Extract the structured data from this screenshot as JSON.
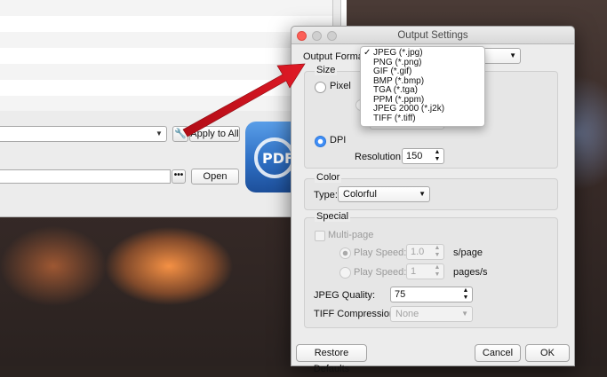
{
  "main_window": {
    "apply_label": "Apply to All",
    "open_label": "Open",
    "ellipsis_label": "•••",
    "wrench_glyph": "🔧",
    "logo_text": "PDF"
  },
  "dialog": {
    "title": "Output Settings",
    "output_format_label": "Output Format:",
    "output_format_selected": "JPEG (*.jpg)",
    "format_options": [
      "JPEG (*.jpg)",
      "PNG (*.png)",
      "GIF (*.gif)",
      "BMP (*.bmp)",
      "TGA (*.tga)",
      "PPM (*.ppm)",
      "JPEG 2000 (*.j2k)",
      "TIFF (*.tiff)"
    ],
    "size_group": "Size",
    "pixel_label": "Pixel",
    "dpi_label": "DPI",
    "resolution_label": "Resolution:",
    "resolution_value": "150",
    "color_group": "Color",
    "type_label": "Type:",
    "type_value": "Colorful",
    "special_group": "Special",
    "multipage_label": "Multi-page",
    "play_speed_label": "Play Speed:",
    "play_speed_value_1": "1.0",
    "play_speed_unit_1": "s/page",
    "play_speed_value_2": "1",
    "play_speed_unit_2": "pages/s",
    "jpeg_quality_label": "JPEG Quality:",
    "jpeg_quality_value": "75",
    "tiff_compression_label": "TIFF Compression:",
    "tiff_compression_value": "None",
    "restore_defaults_label": "Restore Defaults",
    "cancel_label": "Cancel",
    "ok_label": "OK"
  },
  "colors": {
    "accent": "#3f8ef7",
    "annotation_arrow": "#d0121e",
    "close_button": "#fc5f57"
  }
}
